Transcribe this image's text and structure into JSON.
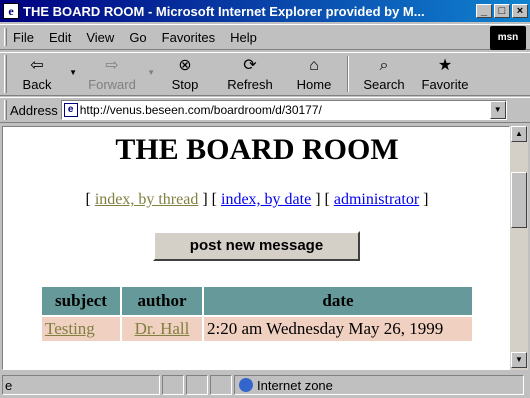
{
  "window": {
    "title": "THE BOARD ROOM - Microsoft Internet Explorer provided by M...",
    "app_icon": "e"
  },
  "menu": [
    "File",
    "Edit",
    "View",
    "Go",
    "Favorites",
    "Help"
  ],
  "brand_logo": "msn",
  "toolbar": {
    "back": "Back",
    "forward": "Forward",
    "stop": "Stop",
    "refresh": "Refresh",
    "home": "Home",
    "search": "Search",
    "favorites": "Favorite"
  },
  "address": {
    "label": "Address",
    "url": "http://venus.beseen.com/boardroom/d/30177/"
  },
  "page": {
    "title": "THE BOARD ROOM",
    "nav": {
      "index_thread": "index, by thread",
      "index_date": "index, by date",
      "administrator": "administrator"
    },
    "post_button": "post new message",
    "table": {
      "headers": [
        "subject",
        "author",
        "date"
      ],
      "rows": [
        {
          "subject": "Testing",
          "author": "Dr. Hall",
          "date": "2:20 am Wednesday May 26, 1999"
        }
      ]
    }
  },
  "status": {
    "zone": "Internet zone"
  },
  "colors": {
    "title_bar": "#000080",
    "table_header": "#669999",
    "table_cell": "#f0d0c0",
    "link": "#0000ee",
    "visited_link": "#808040"
  }
}
